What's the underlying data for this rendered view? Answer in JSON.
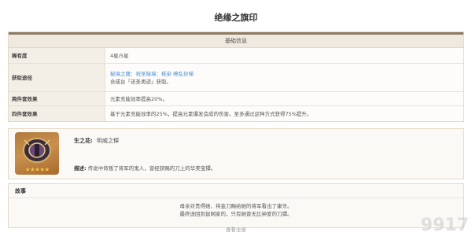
{
  "page": {
    "title": "绝缘之旗印"
  },
  "basic_info": {
    "header": "基础信息",
    "rows": [
      {
        "key": "稀有度",
        "value": "4星/5星"
      },
      {
        "key": "获取途径",
        "value_link": "秘境之籍：祝圣秘境：椛染 缭乱砂梯",
        "value": "合成台「还圣奥迹」获取。"
      },
      {
        "key": "两件套效果",
        "value": "元素充能效率提高20%。"
      },
      {
        "key": "四件套效果",
        "value": "基于元素充能效率的25%，提高元素爆发造成的伤害。至多通过这种方式获得75%提升。"
      }
    ]
  },
  "piece": {
    "slot_label": "生之花:",
    "name": "明威之镡",
    "desc_label": "描述:",
    "desc": "传说中背叛了将军的鬼人，曾经获赐的刀上的华美宝镡。",
    "stars": "★★★★★",
    "icon": "flower-tsuba-icon"
  },
  "story": {
    "header": "故事",
    "lines": [
      "母亲对贵得她、将金刀赐给她的将军看出了康牙。",
      "最终送回到鼠网家的，只有她曾无比钟爱的刀镡。"
    ]
  },
  "footer": {
    "view_all": "查看全部"
  },
  "watermark": "9917"
}
